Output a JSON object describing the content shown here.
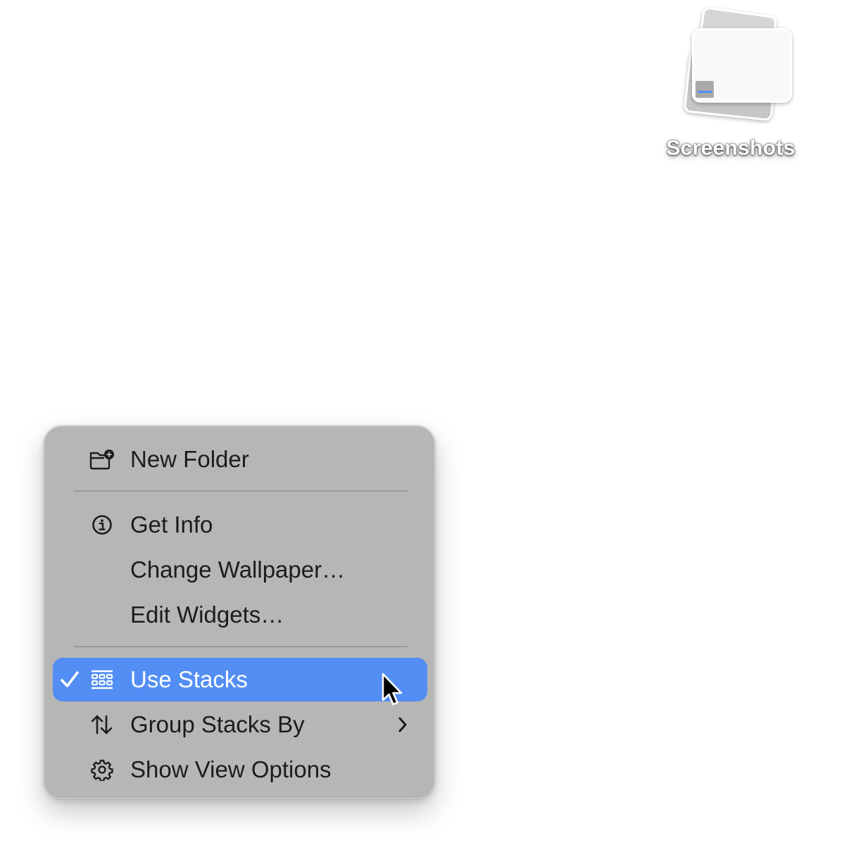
{
  "desktop": {
    "stack": {
      "label": "Screenshots",
      "icon": "screenshots-stack-icon"
    }
  },
  "context_menu": {
    "items": [
      {
        "label": "New Folder",
        "icon": "new-folder-icon"
      },
      {
        "label": "Get Info",
        "icon": "info-icon"
      },
      {
        "label": "Change Wallpaper…"
      },
      {
        "label": "Edit Widgets…"
      },
      {
        "label": "Use Stacks",
        "icon": "stacks-icon",
        "checked": true,
        "highlighted": true
      },
      {
        "label": "Group Stacks By",
        "icon": "sort-arrows-icon",
        "submenu": true
      },
      {
        "label": "Show View Options",
        "icon": "gear-icon"
      }
    ],
    "highlight_color": "#528ef4",
    "background_color": "#b6b6b6"
  },
  "pointer": {
    "icon": "arrow-cursor-icon"
  }
}
